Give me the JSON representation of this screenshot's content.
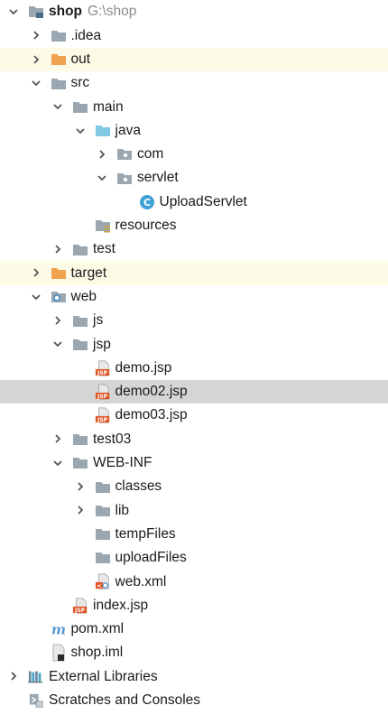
{
  "tree": [
    {
      "id": "shop",
      "label": "shop",
      "sublabel": "G:\\shop",
      "bold": true,
      "indent": 0,
      "arrow": "expanded",
      "icon": "module-folder-icon",
      "highlight": null
    },
    {
      "id": "idea",
      "label": ".idea",
      "indent": 1,
      "arrow": "collapsed",
      "icon": "folder-icon",
      "highlight": null
    },
    {
      "id": "out",
      "label": "out",
      "indent": 1,
      "arrow": "collapsed",
      "icon": "excluded-folder-icon",
      "highlight": "excluded"
    },
    {
      "id": "src",
      "label": "src",
      "indent": 1,
      "arrow": "expanded",
      "icon": "folder-icon",
      "highlight": null
    },
    {
      "id": "main",
      "label": "main",
      "indent": 2,
      "arrow": "expanded",
      "icon": "folder-icon",
      "highlight": null
    },
    {
      "id": "java",
      "label": "java",
      "indent": 3,
      "arrow": "expanded",
      "icon": "source-folder-icon",
      "highlight": null
    },
    {
      "id": "com",
      "label": "com",
      "indent": 4,
      "arrow": "collapsed",
      "icon": "package-icon",
      "highlight": null
    },
    {
      "id": "servlet",
      "label": "servlet",
      "indent": 4,
      "arrow": "expanded",
      "icon": "package-icon",
      "highlight": null
    },
    {
      "id": "uploadservlet",
      "label": "UploadServlet",
      "indent": 5,
      "arrow": "none",
      "icon": "java-class-icon",
      "highlight": null
    },
    {
      "id": "resources",
      "label": "resources",
      "indent": 3,
      "arrow": "none",
      "icon": "resources-folder-icon",
      "highlight": null
    },
    {
      "id": "test",
      "label": "test",
      "indent": 2,
      "arrow": "collapsed",
      "icon": "folder-icon",
      "highlight": null
    },
    {
      "id": "target",
      "label": "target",
      "indent": 1,
      "arrow": "collapsed",
      "icon": "excluded-folder-icon",
      "highlight": "excluded"
    },
    {
      "id": "web",
      "label": "web",
      "indent": 1,
      "arrow": "expanded",
      "icon": "web-folder-icon",
      "highlight": null
    },
    {
      "id": "js",
      "label": "js",
      "indent": 2,
      "arrow": "collapsed",
      "icon": "folder-icon",
      "highlight": null
    },
    {
      "id": "jsp",
      "label": "jsp",
      "indent": 2,
      "arrow": "expanded",
      "icon": "folder-icon",
      "highlight": null
    },
    {
      "id": "demo-jsp",
      "label": "demo.jsp",
      "indent": 3,
      "arrow": "none",
      "icon": "jsp-file-icon",
      "highlight": null
    },
    {
      "id": "demo02-jsp",
      "label": "demo02.jsp",
      "indent": 3,
      "arrow": "none",
      "icon": "jsp-file-icon",
      "highlight": "selected"
    },
    {
      "id": "demo03-jsp",
      "label": "demo03.jsp",
      "indent": 3,
      "arrow": "none",
      "icon": "jsp-file-icon",
      "highlight": null
    },
    {
      "id": "test03",
      "label": "test03",
      "indent": 2,
      "arrow": "collapsed",
      "icon": "folder-icon",
      "highlight": null
    },
    {
      "id": "web-inf",
      "label": "WEB-INF",
      "indent": 2,
      "arrow": "expanded",
      "icon": "folder-icon",
      "highlight": null
    },
    {
      "id": "classes",
      "label": "classes",
      "indent": 3,
      "arrow": "collapsed",
      "icon": "folder-icon",
      "highlight": null
    },
    {
      "id": "lib",
      "label": "lib",
      "indent": 3,
      "arrow": "collapsed",
      "icon": "folder-icon",
      "highlight": null
    },
    {
      "id": "tempfiles",
      "label": "tempFiles",
      "indent": 3,
      "arrow": "none",
      "icon": "folder-icon",
      "highlight": null
    },
    {
      "id": "uploadfiles",
      "label": "uploadFiles",
      "indent": 3,
      "arrow": "none",
      "icon": "folder-icon",
      "highlight": null
    },
    {
      "id": "web-xml",
      "label": "web.xml",
      "indent": 3,
      "arrow": "none",
      "icon": "web-xml-icon",
      "highlight": null
    },
    {
      "id": "index-jsp",
      "label": "index.jsp",
      "indent": 2,
      "arrow": "none",
      "icon": "jsp-file-icon",
      "highlight": null
    },
    {
      "id": "pom-xml",
      "label": "pom.xml",
      "indent": 1,
      "arrow": "none",
      "icon": "maven-icon",
      "highlight": null
    },
    {
      "id": "shop-iml",
      "label": "shop.iml",
      "indent": 1,
      "arrow": "none",
      "icon": "iml-file-icon",
      "highlight": null
    },
    {
      "id": "external-libraries",
      "label": "External Libraries",
      "indent": 0,
      "arrow": "collapsed",
      "icon": "libraries-icon",
      "highlight": null
    },
    {
      "id": "scratches",
      "label": "Scratches and Consoles",
      "indent": 0,
      "arrow": "none",
      "icon": "scratches-icon",
      "highlight": null
    }
  ],
  "colors": {
    "folder": "#9aa7b0",
    "excluded_folder": "#f0a24f",
    "source_folder": "#81c8e3",
    "java_class": "#3fa3d6",
    "jsp_badge": "#e0582a",
    "arrow": "#555555",
    "maven": "#5a9bd5"
  }
}
